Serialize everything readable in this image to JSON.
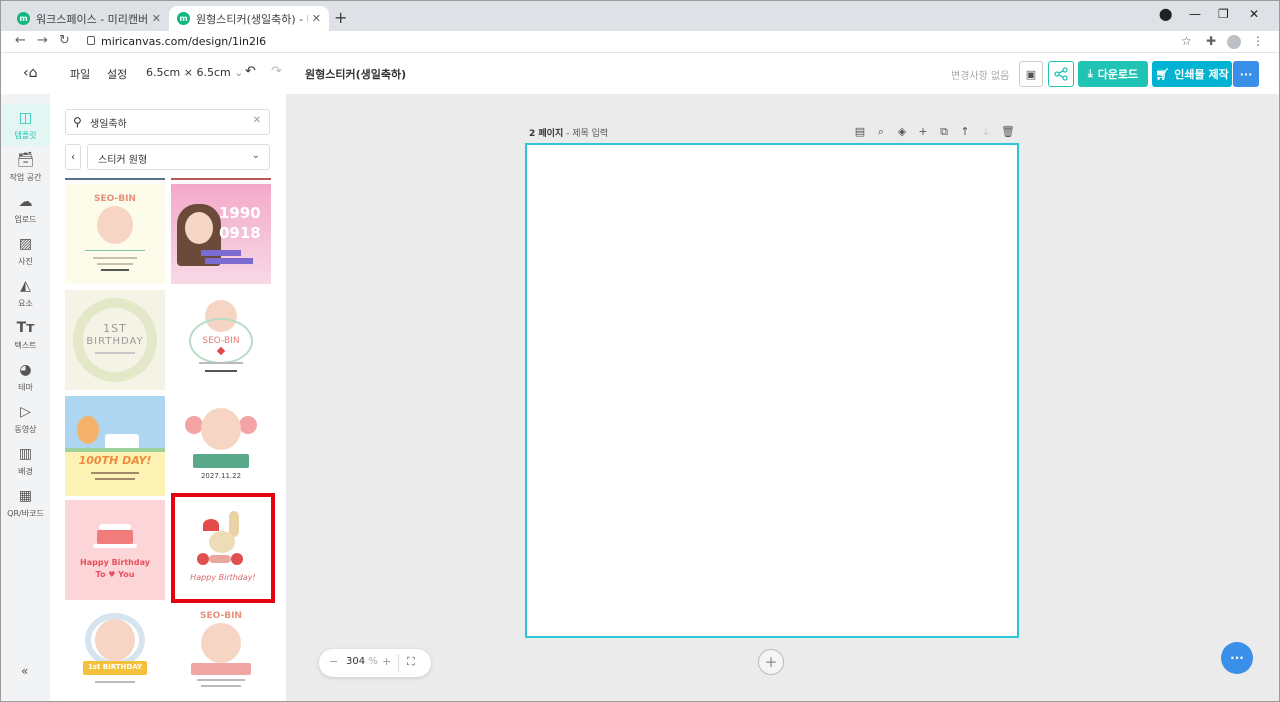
{
  "browser": {
    "tabs": [
      {
        "favicon": "m",
        "title": "워크스페이스 - 미리캔버스",
        "close": "✕"
      },
      {
        "favicon": "m",
        "title": "원형스티커(생일축하) - 미리캔버스",
        "close": "✕"
      }
    ],
    "new_tab": "+",
    "url": "miricanvas.com/design/1in2l6"
  },
  "header": {
    "file_label": "파일",
    "settings_label": "설정",
    "size_label": "6.5cm × 6.5cm",
    "doc_title": "원형스티커(생일축하)",
    "save_status": "변경사항 없음",
    "download_label": "다운로드",
    "print_label": "인쇄물 제작",
    "more_label": "···"
  },
  "sidebar": {
    "items": [
      {
        "icon": "template-icon",
        "label": "템플릿"
      },
      {
        "icon": "workspace-icon",
        "label": "작업 공간"
      },
      {
        "icon": "upload-icon",
        "label": "업로드"
      },
      {
        "icon": "photo-icon",
        "label": "사진"
      },
      {
        "icon": "elements-icon",
        "label": "요소"
      },
      {
        "icon": "text-icon",
        "label": "텍스트"
      },
      {
        "icon": "theme-icon",
        "label": "테마"
      },
      {
        "icon": "video-icon",
        "label": "동영상"
      },
      {
        "icon": "background-icon",
        "label": "배경"
      },
      {
        "icon": "qr-icon",
        "label": "QR/바코드"
      }
    ],
    "collapse": "«"
  },
  "panel": {
    "search_value": "생일축하",
    "category": "스티커 원형",
    "templates": [
      {
        "caption": "SEO-BIN"
      },
      {
        "caption_line1": "1990",
        "caption_line2": "0918"
      },
      {
        "caption_line1": "1ST",
        "caption_line2": "BIRTHDAY"
      },
      {
        "caption": "SEO-BIN"
      },
      {
        "caption": "100TH DAY!"
      },
      {
        "caption": "2027.11.22"
      },
      {
        "caption_line1": "Happy Birthday",
        "caption_line2": "To ♥ You"
      },
      {
        "caption": "Happy Birthday!"
      },
      {
        "caption": "1st BIRTHDAY"
      },
      {
        "caption": "SEO-BIN"
      }
    ],
    "selected_index": 7
  },
  "canvas": {
    "page_label": "2 페이지",
    "page_title_placeholder": "제목 입력",
    "zoom_minus": "−",
    "zoom_value": "304",
    "zoom_unit": "%",
    "zoom_plus": "+",
    "add_page": "+",
    "chat_label": "···"
  },
  "colors": {
    "accent_teal": "#21c4b4",
    "print_cyan": "#00b3d2",
    "more_blue": "#3a8fe8",
    "selection_red": "#e60012",
    "page_border": "#2fc5d6"
  }
}
